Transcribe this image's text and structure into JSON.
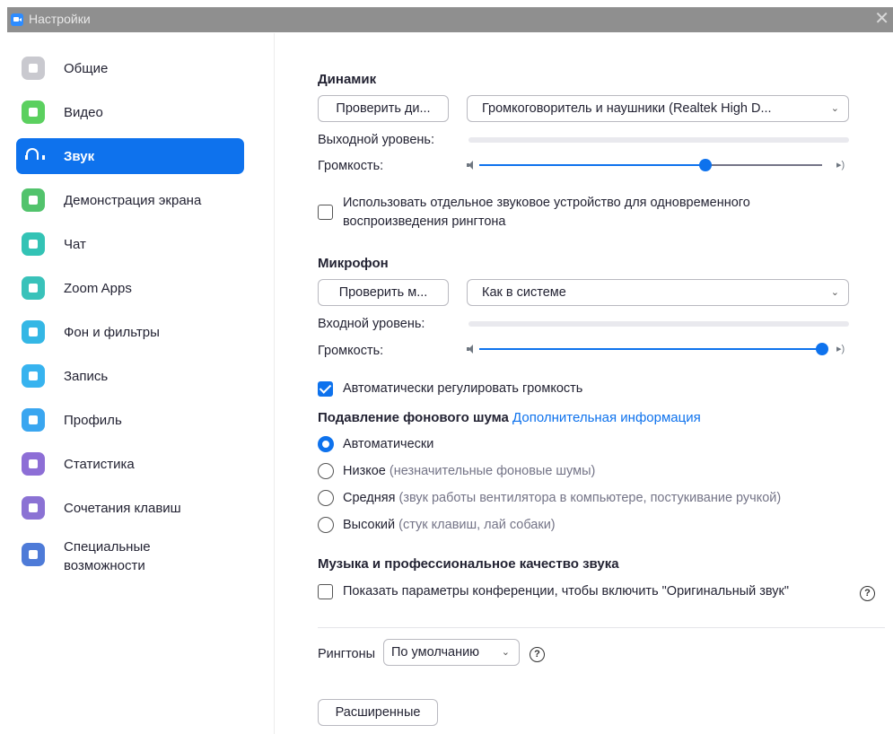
{
  "window": {
    "title": "Настройки",
    "close": "✕"
  },
  "sidebar": {
    "items": [
      {
        "label": "Общие",
        "icon": "gear-icon",
        "color": "#c9c9cf"
      },
      {
        "label": "Видео",
        "icon": "video-icon",
        "color": "#5bd05f"
      },
      {
        "label": "Звук",
        "icon": "headphones-icon",
        "color": "#0e72ed",
        "active": true
      },
      {
        "label": "Демонстрация экрана",
        "icon": "share-screen-icon",
        "color": "#52c36c"
      },
      {
        "label": "Чат",
        "icon": "chat-icon",
        "color": "#33c3b5"
      },
      {
        "label": "Zoom Apps",
        "icon": "apps-icon",
        "color": "#39c2ba"
      },
      {
        "label": "Фон и фильтры",
        "icon": "background-icon",
        "color": "#34b7e5"
      },
      {
        "label": "Запись",
        "icon": "record-icon",
        "color": "#37b3ef"
      },
      {
        "label": "Профиль",
        "icon": "profile-icon",
        "color": "#3aa6f0"
      },
      {
        "label": "Статистика",
        "icon": "statistics-icon",
        "color": "#8d6ed6"
      },
      {
        "label": "Сочетания клавиш",
        "icon": "keyboard-icon",
        "color": "#8b72d4"
      },
      {
        "label": "Специальные возможности",
        "icon": "accessibility-icon",
        "color": "#4e7bd8"
      }
    ]
  },
  "speaker": {
    "title": "Динамик",
    "test_button": "Проверить ди...",
    "device": "Громкоговоритель и наушники (Realtek High D...",
    "output_level_label": "Выходной уровень:",
    "volume_label": "Громкость:",
    "volume": 0.66
  },
  "separate_ringtone": {
    "checked": false,
    "label_line1": "Использовать отдельное звуковое устройство для одновременного",
    "label_line2": "воспроизведения рингтона"
  },
  "microphone": {
    "title": "Микрофон",
    "test_button": "Проверить м...",
    "device": "Как в системе",
    "input_level_label": "Входной уровень:",
    "volume_label": "Громкость:",
    "volume": 1.0
  },
  "auto_adjust": {
    "checked": true,
    "label": "Автоматически регулировать громкость"
  },
  "noise": {
    "title": "Подавление фонового шума",
    "link": "Дополнительная информация",
    "options": [
      {
        "label": "Автоматически",
        "hint": "",
        "checked": true
      },
      {
        "label": "Низкое",
        "hint": "(незначительные фоновые шумы)",
        "checked": false
      },
      {
        "label": "Средняя",
        "hint": "(звук работы вентилятора в компьютере, постукивание ручкой)",
        "checked": false
      },
      {
        "label": "Высокий",
        "hint": "(стук клавиш, лай собаки)",
        "checked": false
      }
    ]
  },
  "music": {
    "title": "Музыка и профессиональное качество звука",
    "original_sound_checked": false,
    "original_sound_label": "Показать параметры конференции, чтобы включить \"Оригинальный звук\"",
    "help": "?"
  },
  "ringtones": {
    "label": "Рингтоны",
    "value": "По умолчанию",
    "help": "?"
  },
  "advanced_button": "Расширенные"
}
